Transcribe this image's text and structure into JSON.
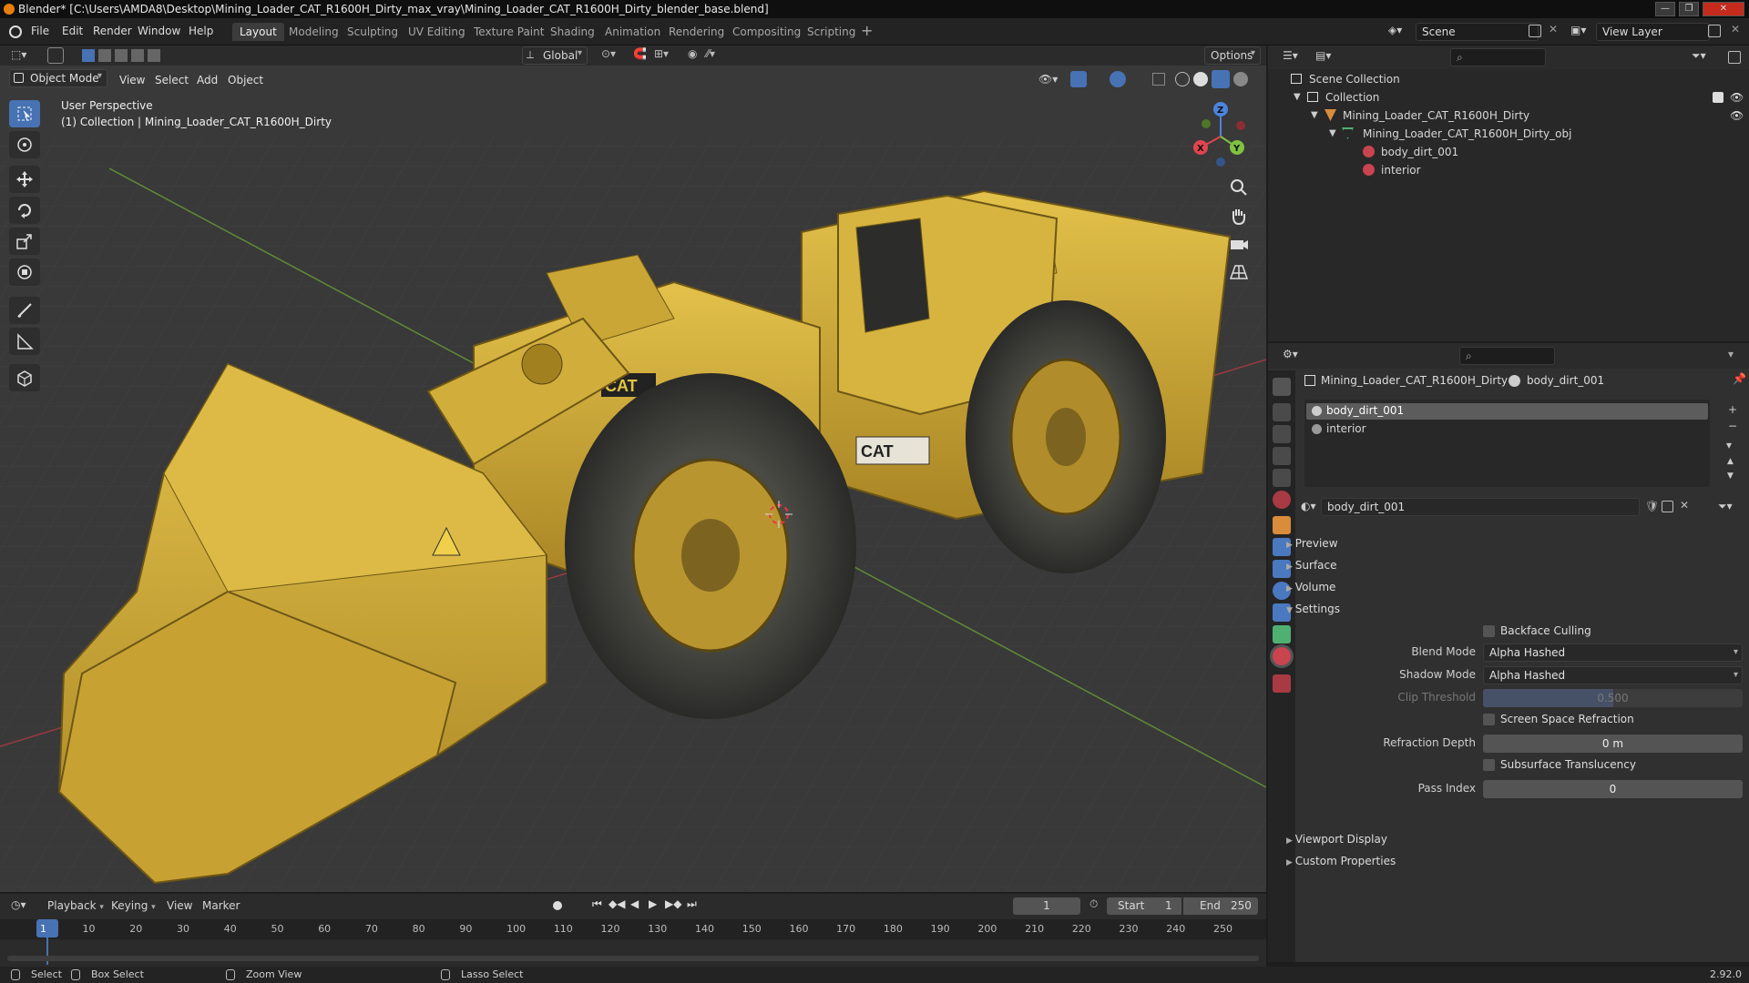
{
  "window": {
    "title": "Blender* [C:\\Users\\AMDA8\\Desktop\\Mining_Loader_CAT_R1600H_Dirty_max_vray\\Mining_Loader_CAT_R1600H_Dirty_blender_base.blend]"
  },
  "menu": [
    "File",
    "Edit",
    "Render",
    "Window",
    "Help"
  ],
  "workspaces": [
    "Layout",
    "Modeling",
    "Sculpting",
    "UV Editing",
    "Texture Paint",
    "Shading",
    "Animation",
    "Rendering",
    "Compositing",
    "Scripting"
  ],
  "active_workspace": "Layout",
  "scene_field": "Scene",
  "view_layer_field": "View Layer",
  "viewport": {
    "mode": "Object Mode",
    "menus": [
      "View",
      "Select",
      "Add",
      "Object"
    ],
    "orientation": "Global",
    "options_label": "Options",
    "info_line1": "User Perspective",
    "info_line2": "(1) Collection | Mining_Loader_CAT_R1600H_Dirty",
    "gizmo_axes": [
      "X",
      "Y",
      "Z"
    ]
  },
  "outliner": {
    "root": "Scene Collection",
    "collection": "Collection",
    "object": "Mining_Loader_CAT_R1600H_Dirty",
    "mesh": "Mining_Loader_CAT_R1600H_Dirty_obj",
    "materials": [
      "body_dirt_001",
      "interior"
    ]
  },
  "properties": {
    "breadcrumb_object": "Mining_Loader_CAT_R1600H_Dirty",
    "breadcrumb_material": "body_dirt_001",
    "slots": [
      "body_dirt_001",
      "interior"
    ],
    "active_slot": "body_dirt_001",
    "material_name": "body_dirt_001",
    "panels": [
      "Preview",
      "Surface",
      "Volume",
      "Settings"
    ],
    "settings": {
      "backface_culling": "Backface Culling",
      "blend_mode_label": "Blend Mode",
      "blend_mode_value": "Alpha Hashed",
      "shadow_mode_label": "Shadow Mode",
      "shadow_mode_value": "Alpha Hashed",
      "clip_threshold_label": "Clip Threshold",
      "clip_threshold_value": "0.500",
      "ssr_label": "Screen Space Refraction",
      "refraction_depth_label": "Refraction Depth",
      "refraction_depth_value": "0 m",
      "subsurface_label": "Subsurface Translucency",
      "pass_index_label": "Pass Index",
      "pass_index_value": "0"
    },
    "lower_panels": [
      "Viewport Display",
      "Custom Properties"
    ]
  },
  "timeline": {
    "menus": [
      "Playback",
      "Keying",
      "View",
      "Marker"
    ],
    "current_frame": "1",
    "start_label": "Start",
    "start_value": "1",
    "end_label": "End",
    "end_value": "250",
    "ruler": [
      "1",
      "10",
      "20",
      "30",
      "40",
      "50",
      "60",
      "70",
      "80",
      "90",
      "100",
      "110",
      "120",
      "130",
      "140",
      "150",
      "160",
      "170",
      "180",
      "190",
      "200",
      "210",
      "220",
      "230",
      "240",
      "250"
    ]
  },
  "statusbar": {
    "select": "Select",
    "box_select": "Box Select",
    "zoom_view": "Zoom View",
    "lasso_select": "Lasso Select",
    "version": "2.92.0"
  },
  "colors": {
    "accent": "#4772b3",
    "loader_yellow": "#d8b43a",
    "axis_x": "#e0454f",
    "axis_y": "#7fc241",
    "axis_z": "#4c84dd"
  }
}
